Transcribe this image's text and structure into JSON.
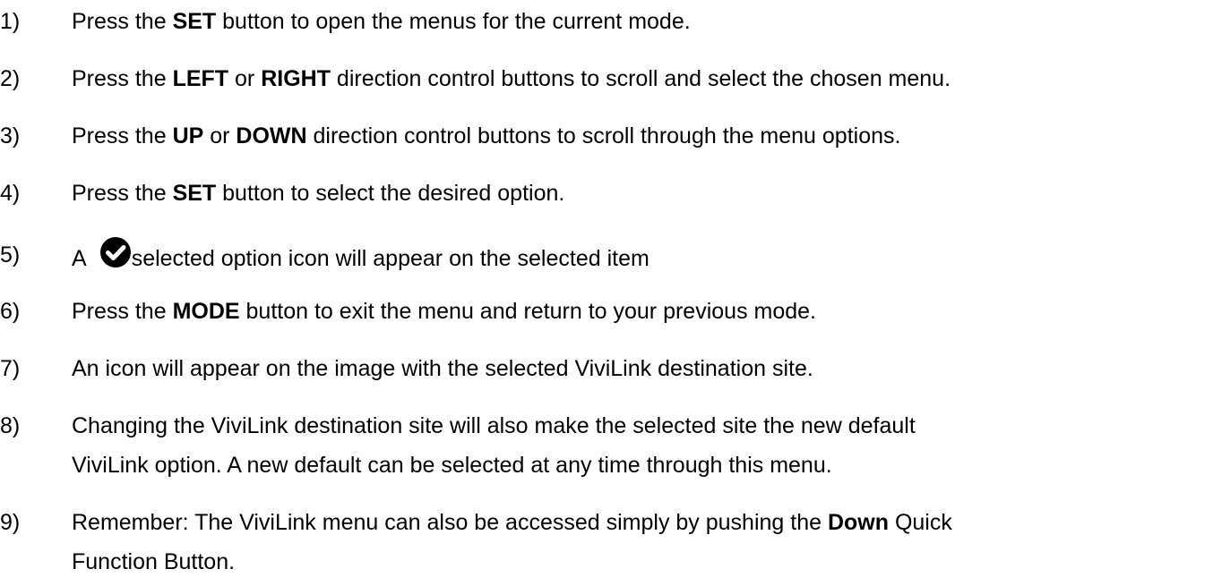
{
  "steps": [
    {
      "number": "1)",
      "parts": [
        "Press the ",
        "SET",
        " button to open the menus for the current mode."
      ]
    },
    {
      "number": "2)",
      "parts": [
        "Press the ",
        "LEFT",
        " or ",
        "RIGHT",
        " direction control buttons to scroll and select the chosen menu."
      ]
    },
    {
      "number": "3)",
      "parts": [
        "Press the ",
        "UP",
        " or ",
        "DOWN",
        " direction control buttons to scroll through the menu options."
      ]
    },
    {
      "number": "4)",
      "parts": [
        "Press the ",
        "SET",
        " button to select the desired option."
      ]
    },
    {
      "number": "5)",
      "parts": [
        "A",
        "selected option icon will appear on the selected item"
      ],
      "icon": "check-circle-icon"
    },
    {
      "number": "6)",
      "parts": [
        "Press the ",
        "MODE",
        " button to exit the menu and return to your previous mode."
      ]
    },
    {
      "number": "7)",
      "parts": [
        "An icon will appear on the image with the selected ViviLink destination site."
      ]
    },
    {
      "number": "8)",
      "lines": [
        "Changing the ViviLink destination site will also make the selected site the new default",
        "ViviLink option. A new default can be selected at any time through this menu."
      ]
    },
    {
      "number": "9)",
      "parts": [
        "Remember: The ViviLink menu can also be accessed simply by pushing the ",
        "Down",
        " Quick"
      ],
      "continuation": "Function Button."
    }
  ]
}
